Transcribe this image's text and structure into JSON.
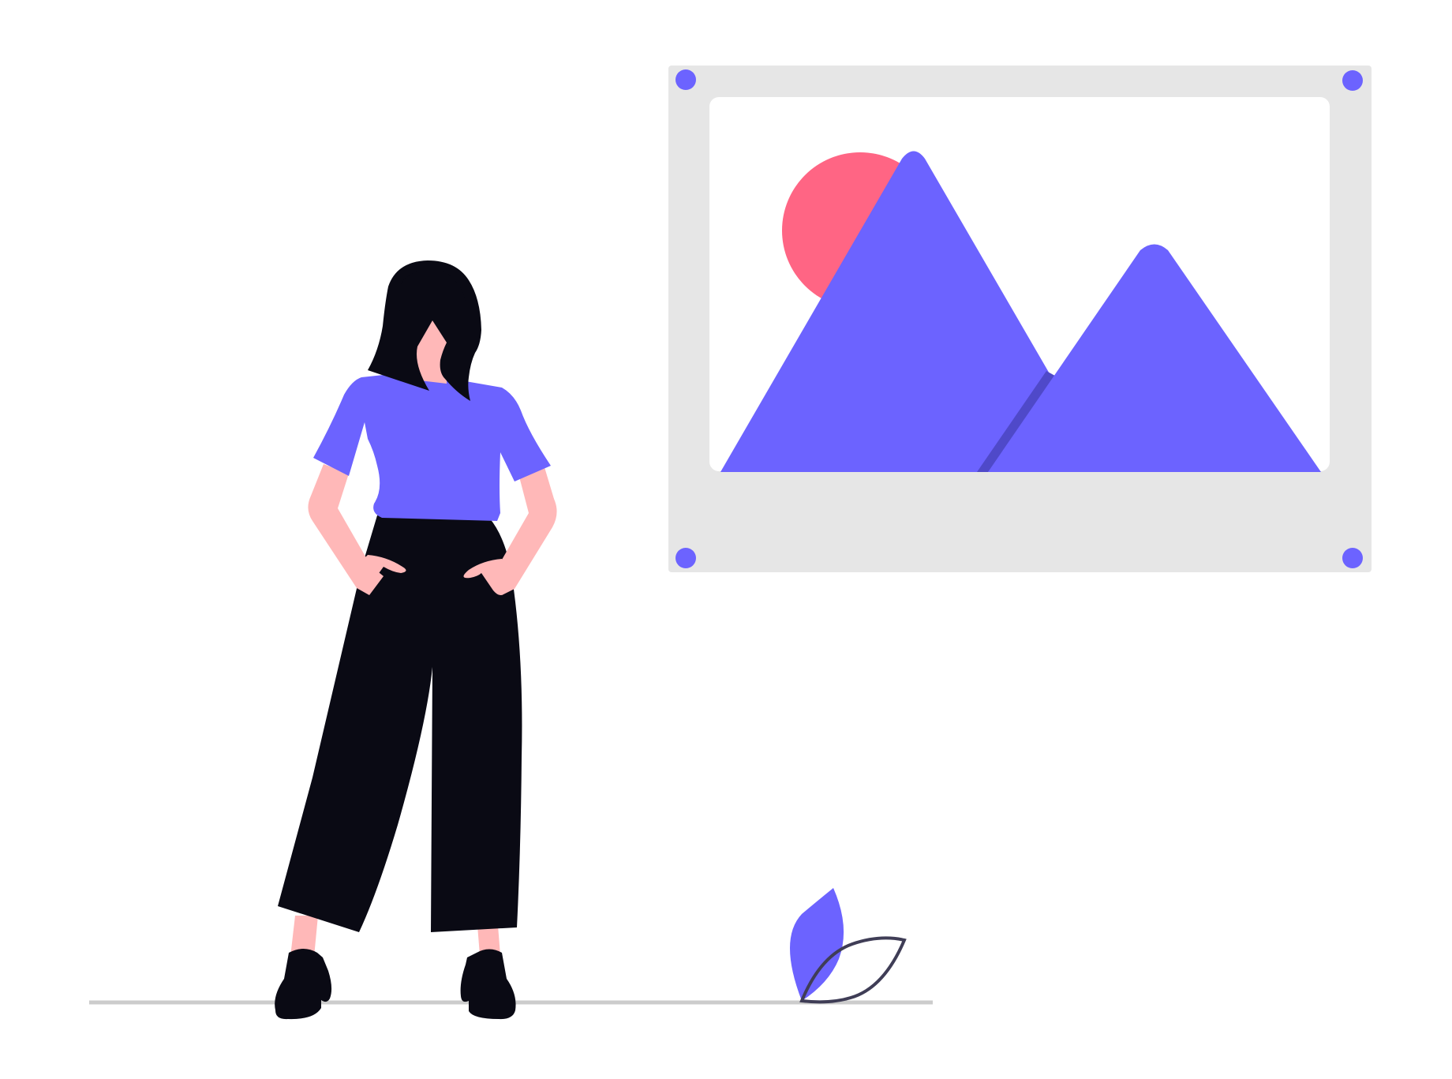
{
  "illustration": {
    "colors": {
      "primary": "#6c63ff",
      "primary_shadow": "#4f49c9",
      "sun": "#ff6584",
      "frame": "#e6e6e6",
      "canvas": "#ffffff",
      "skin": "#ffb8b8",
      "dark": "#0a0a14",
      "ground": "#cccccc",
      "leaf_outline": "#3f3d56"
    },
    "icons": {
      "person": "woman-standing-icon",
      "picture": "image-placeholder-icon",
      "sun": "sun-icon",
      "mountain_large": "mountain-icon",
      "mountain_small": "mountain-icon",
      "plant": "plant-icon",
      "screw": "screw-icon"
    }
  }
}
